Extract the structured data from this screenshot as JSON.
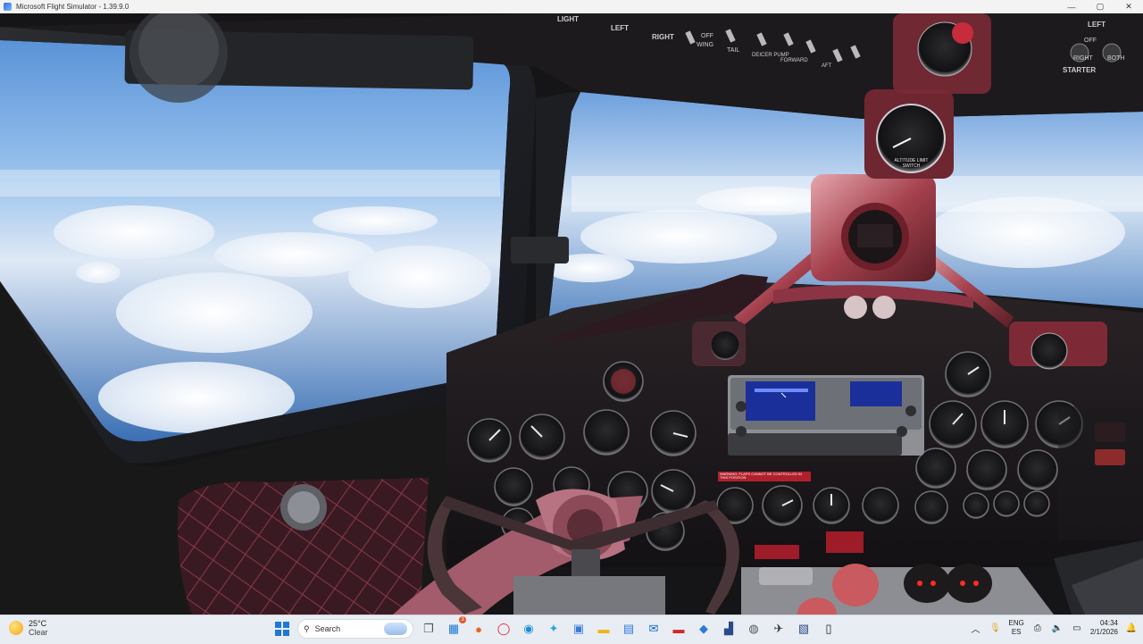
{
  "window": {
    "title": "Microsoft Flight Simulator - 1.39.9.0",
    "controls": [
      "—",
      "▢",
      "✕"
    ]
  },
  "cockpit": {
    "overhead_labels": {
      "light": "LIGHT",
      "left": "LEFT",
      "right": "RIGHT",
      "off": "OFF",
      "wing": "WING",
      "tail": "TAIL",
      "deicer_pump": "DEICER PUMP",
      "forward": "FORWARD",
      "aft": "AFT",
      "engine_left": "LEFT",
      "engine_off": "OFF",
      "engine_right": "RIGHT",
      "engine_both": "BOTH",
      "starter": "STARTER"
    },
    "altitude_limit_label": "ALTITUDE LIMIT SWITCH",
    "warning_placard": "WARNING: FLAPS CANNOT BE CONTROLLED IN THIS POSITION"
  },
  "taskbar": {
    "weather": {
      "temp": "25°C",
      "condition": "Clear"
    },
    "search": {
      "placeholder": "Search"
    },
    "apps": [
      {
        "name": "task-view"
      },
      {
        "name": "widgets"
      },
      {
        "name": "firefox"
      },
      {
        "name": "opera"
      },
      {
        "name": "edge"
      },
      {
        "name": "copilot"
      },
      {
        "name": "store"
      },
      {
        "name": "file-explorer"
      },
      {
        "name": "calendar"
      },
      {
        "name": "outlook"
      },
      {
        "name": "app-red"
      },
      {
        "name": "app-blue"
      },
      {
        "name": "app-bag"
      },
      {
        "name": "chrome"
      },
      {
        "name": "flight-sim"
      },
      {
        "name": "app-msfs"
      },
      {
        "name": "app-phone"
      }
    ],
    "apps_badge": "3",
    "language": {
      "code": "ENG",
      "region": "ES"
    },
    "clock": {
      "time": "04:34",
      "date": "2/1/2026"
    }
  }
}
